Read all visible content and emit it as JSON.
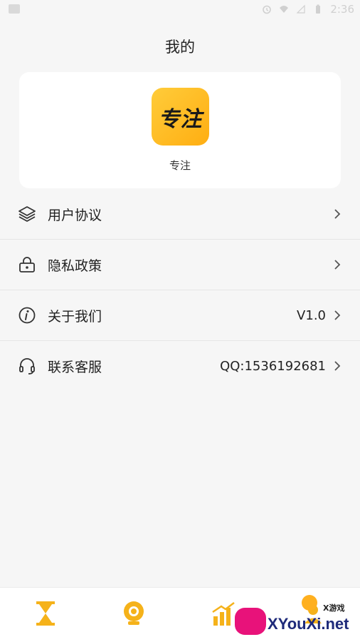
{
  "status_bar": {
    "time": "2:36"
  },
  "page": {
    "title": "我的"
  },
  "profile": {
    "logo_text": "专注",
    "app_name": "专注"
  },
  "menu": [
    {
      "label": "用户协议",
      "value": "",
      "icon": "layers-icon"
    },
    {
      "label": "隐私政策",
      "value": "",
      "icon": "lock-icon"
    },
    {
      "label": "关于我们",
      "value": "V1.0",
      "icon": "info-icon"
    },
    {
      "label": "联系客服",
      "value": "QQ:1536192681",
      "icon": "headset-icon"
    }
  ],
  "tabbar": {
    "tabs": [
      {
        "icon": "hourglass-icon"
      },
      {
        "icon": "camera-icon"
      },
      {
        "icon": "chart-icon"
      },
      {
        "icon": "profile-icon"
      }
    ],
    "accent": "#f5b21a"
  },
  "watermark": {
    "text": "XYouXi.net",
    "small": "X游戏"
  }
}
